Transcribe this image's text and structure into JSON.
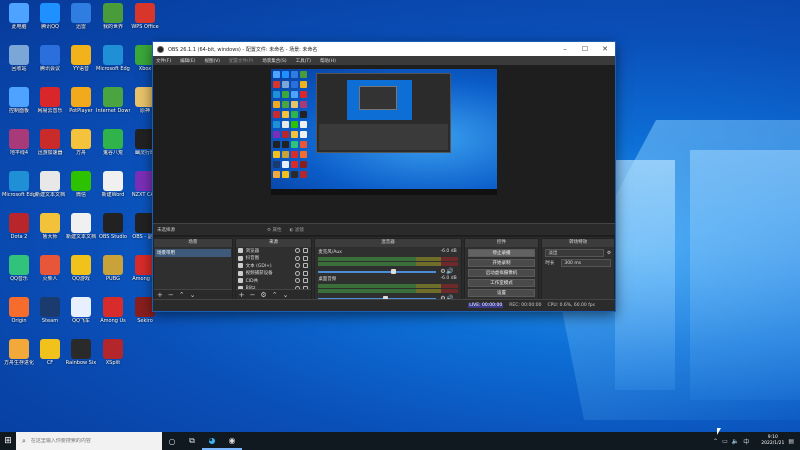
{
  "desktop": {
    "icons": [
      {
        "label": "此电脑",
        "color": "#4da3ff"
      },
      {
        "label": "腾讯QQ",
        "color": "#1e90ff"
      },
      {
        "label": "迅雷",
        "color": "#2f7de0"
      },
      {
        "label": "我的世界",
        "color": "#4a9b3a"
      },
      {
        "label": "WPS Office",
        "color": "#d9362b"
      },
      {
        "label": "回收站",
        "color": "#7aa7d8"
      },
      {
        "label": "腾讯会议",
        "color": "#2b6fdc"
      },
      {
        "label": "YY语音",
        "color": "#f2b21c"
      },
      {
        "label": "Microsoft Edge",
        "color": "#1f8fd6"
      },
      {
        "label": "Xbox",
        "color": "#3aa83a"
      },
      {
        "label": "控制面板",
        "color": "#4da3ff"
      },
      {
        "label": "网易云音乐",
        "color": "#d8262b"
      },
      {
        "label": "PotPlayer",
        "color": "#f2a91c"
      },
      {
        "label": "Internet Download",
        "color": "#4aa540"
      },
      {
        "label": "原神",
        "color": "#e8c36a"
      },
      {
        "label": "地平线4",
        "color": "#a93a7a"
      },
      {
        "label": "迅游加速器",
        "color": "#c92b2b"
      },
      {
        "label": "方舟",
        "color": "#f5c23b"
      },
      {
        "label": "鬼谷八荒",
        "color": "#2fb34a"
      },
      {
        "label": "幽灵行动",
        "color": "#222222"
      },
      {
        "label": "Microsoft Edge",
        "color": "#1f8fd6"
      },
      {
        "label": "新建文本文档",
        "color": "#e8e8e8"
      },
      {
        "label": "微信",
        "color": "#2dc100"
      },
      {
        "label": "新建Word",
        "color": "#f0f0f0"
      },
      {
        "label": "NZXT CAM",
        "color": "#7b2fb8"
      },
      {
        "label": "Dota 2",
        "color": "#b8262b"
      },
      {
        "label": "鲁大师",
        "color": "#f2c23a"
      },
      {
        "label": "新建文本文档",
        "color": "#f0f0f0"
      },
      {
        "label": "OBS Studio",
        "color": "#222222"
      },
      {
        "label": "OBS - 副本",
        "color": "#222222"
      },
      {
        "label": "QQ音乐",
        "color": "#31c27c"
      },
      {
        "label": "火柴人",
        "color": "#e8563a"
      },
      {
        "label": "QQ游戏",
        "color": "#f2c21c"
      },
      {
        "label": "PUBG",
        "color": "#c9a23a"
      },
      {
        "label": "Among Us",
        "color": "#d82b2b"
      },
      {
        "label": "Origin",
        "color": "#f56c2d"
      },
      {
        "label": "Steam",
        "color": "#1b3b6e"
      },
      {
        "label": "QQ飞车",
        "color": "#e8f0ff"
      },
      {
        "label": "Among Us",
        "color": "#d82b2b"
      },
      {
        "label": "Sekiro",
        "color": "#8a1e1e"
      },
      {
        "label": "方舟生存进化",
        "color": "#f2a93a"
      },
      {
        "label": "CF",
        "color": "#f2c21c"
      },
      {
        "label": "Rainbow Six",
        "color": "#2a2a2a"
      },
      {
        "label": "XSplit",
        "color": "#b3262b"
      }
    ]
  },
  "obs": {
    "title": "OBS 26.1.1 (64-bit, windows) - 配置文件: 未命名 - 场景: 未命名",
    "menu": [
      "文件(F)",
      "编辑(E)",
      "视图(V)",
      "配置文件(P)",
      "场景集合(S)",
      "工具(T)",
      "帮助(H)"
    ],
    "no_source": "未选择源",
    "props_btn": "⚙ 属性",
    "filters_btn": "◐ 滤镜",
    "docks": {
      "scenes": "场景",
      "sources": "来源",
      "mixer": "混音器",
      "controls": "控件",
      "transitions": "转场特效"
    },
    "scene": "场景带用",
    "sources": [
      "浏览器",
      "抖音图",
      "文本 (GDI+)",
      "视频捕获设备",
      "CID共",
      "Blitz",
      "显示器捕获"
    ],
    "mixer": [
      {
        "name": "麦克风/Aux",
        "db": "-6.0 dB",
        "level": 0.62
      },
      {
        "name": "桌面音频",
        "db": "-6.0 dB",
        "level": 0.55
      }
    ],
    "controls": [
      "停止录播",
      "开始录制",
      "启动虚拟摄像机",
      "工作室模式",
      "设置",
      "退出"
    ],
    "transition_type": "淡出",
    "duration_label": "时长",
    "duration": "300 ms",
    "status": {
      "live": "LIVE: 00:00:00",
      "rec": "REC: 00:00:00",
      "cpu": "CPU: 0.6%, 60.00 fps"
    }
  },
  "taskbar": {
    "search_placeholder": "在这里输入你要搜索的内容",
    "time": "9:10",
    "date": "2022/1/21"
  }
}
